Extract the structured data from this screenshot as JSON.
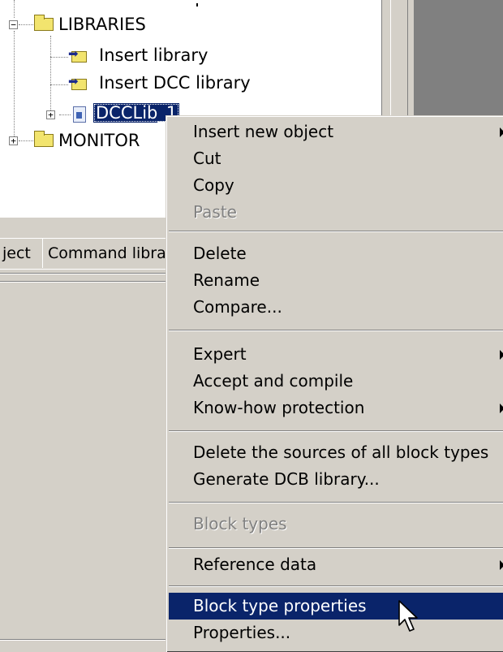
{
  "tree": {
    "items": [
      {
        "label": "LIBRARIES",
        "expander": "−"
      },
      {
        "label": "Insert library"
      },
      {
        "label": "Insert DCC library"
      },
      {
        "label": "DCCLib_1",
        "expander": "+"
      },
      {
        "label": "MONITOR",
        "expander": "+"
      }
    ]
  },
  "tabs": [
    {
      "label": "ject"
    },
    {
      "label": "Command libra"
    }
  ],
  "menu": {
    "items": [
      {
        "label": "Insert new object"
      },
      {
        "label": "Cut"
      },
      {
        "label": "Copy"
      },
      {
        "label": "Paste"
      },
      {
        "label": "Delete"
      },
      {
        "label": "Rename"
      },
      {
        "label": "Compare..."
      },
      {
        "label": "Expert"
      },
      {
        "label": "Accept and compile"
      },
      {
        "label": "Know-how protection"
      },
      {
        "label": "Delete the sources of all block types"
      },
      {
        "label": "Generate DCB library..."
      },
      {
        "label": "Block types"
      },
      {
        "label": "Reference data"
      },
      {
        "label": "Block type properties"
      },
      {
        "label": "Properties..."
      }
    ]
  },
  "icons": {
    "cursor": "arrow-cursor-icon",
    "folder": "folder-icon",
    "insert": "insert-library-icon",
    "library": "library-icon"
  },
  "colors": {
    "selection": "#0a246a",
    "face": "#d4d0c8",
    "disabled": "#808080"
  }
}
